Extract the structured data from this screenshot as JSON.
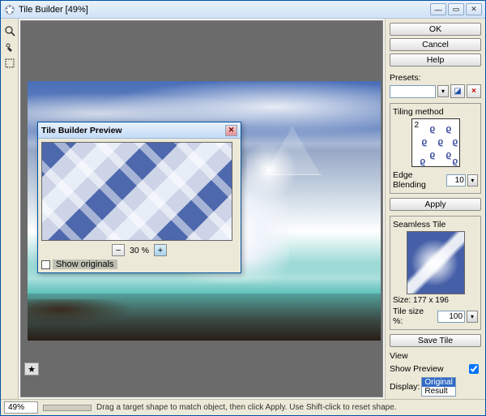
{
  "window": {
    "title": "Tile Builder [49%]"
  },
  "status": {
    "zoom": "49%",
    "hint": "Drag a target shape to match object, then click Apply. Use Shift-click to reset shape."
  },
  "right": {
    "ok": "OK",
    "cancel": "Cancel",
    "help": "Help",
    "presets_label": "Presets:",
    "tiling_group": "Tiling method",
    "tiling_num": "2",
    "edge_label": "Edge Blending",
    "edge_value": "10",
    "apply": "Apply",
    "seamless_group": "Seamless Tile",
    "size": "Size: 177 x 196",
    "tile_size_label": "Tile size %:",
    "tile_size_value": "100",
    "save_tile": "Save Tile",
    "view_label": "View",
    "show_preview": "Show Preview",
    "display_label": "Display:",
    "display_options": {
      "opt0": "Original",
      "opt1": "Result"
    }
  },
  "preview": {
    "title": "Tile Builder Preview",
    "zoom": "30 %",
    "show_originals": "Show originals"
  }
}
